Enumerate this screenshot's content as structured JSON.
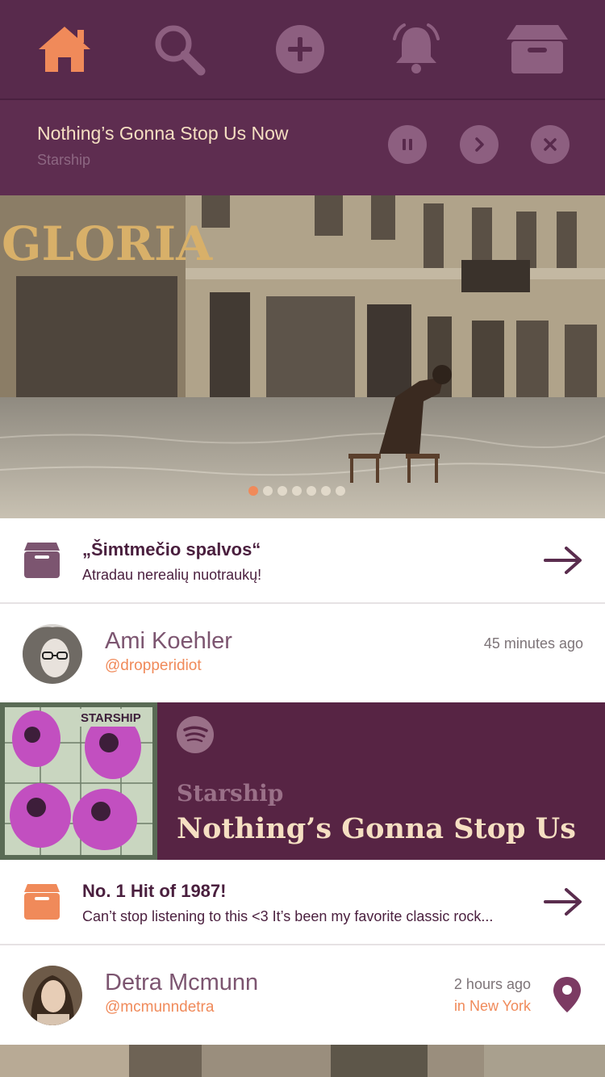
{
  "colors": {
    "nav_bg": "#582a4c",
    "accent": "#f08a5a",
    "icon_inactive": "#8d5f80",
    "cream": "#f5dfc2"
  },
  "nav": {
    "items": [
      {
        "icon": "home-icon",
        "active": true
      },
      {
        "icon": "search-icon",
        "active": false
      },
      {
        "icon": "add-icon",
        "active": false
      },
      {
        "icon": "bell-icon",
        "active": false
      },
      {
        "icon": "box-icon",
        "active": false
      }
    ]
  },
  "now_playing": {
    "title": "Nothing’s Gonna Stop Us Now",
    "artist": "Starship"
  },
  "hero": {
    "sign_text": "GLORIA",
    "slides_total": 7,
    "active_slide": 1
  },
  "post1": {
    "title": "„Šimtmečio spalvos“",
    "description": "Atradau nerealių nuotraukų!"
  },
  "user1": {
    "name": "Ami Koehler",
    "handle": "@dropperidiot",
    "time": "45 minutes ago"
  },
  "spotify_card": {
    "album_text": "STARSHIP",
    "artist": "Starship",
    "track": "Nothing’s Gonna Stop Us"
  },
  "post2": {
    "title": "No. 1 Hit of 1987!",
    "description": "Can’t stop listening to this <3 It’s been my favorite classic rock..."
  },
  "user2": {
    "name": "Detra Mcmunn",
    "handle": "@mcmunndetra",
    "time": "2 hours ago",
    "location": "in New York"
  }
}
